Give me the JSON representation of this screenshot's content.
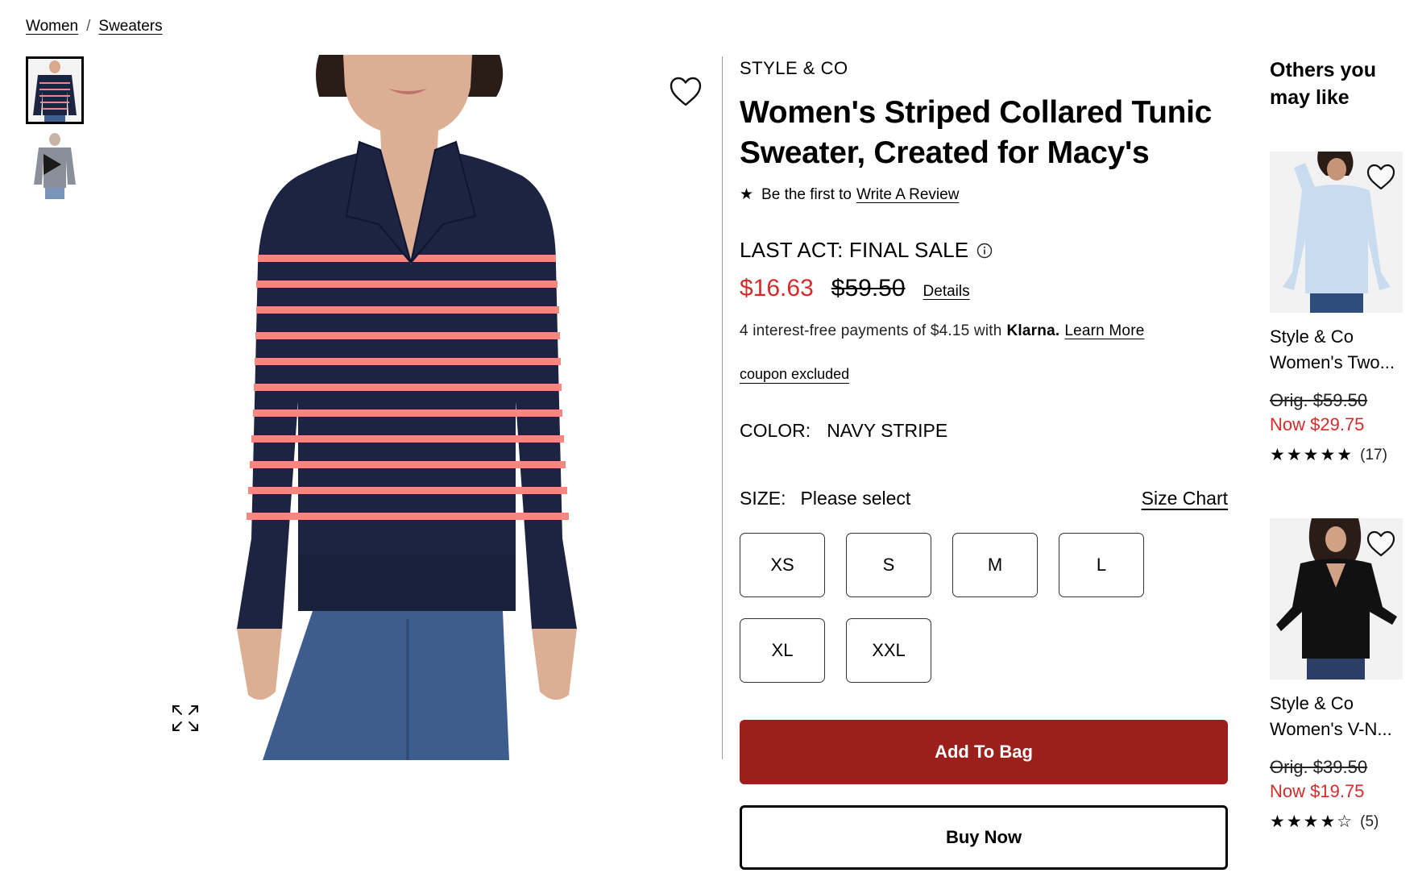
{
  "breadcrumb": {
    "items": [
      "Women",
      "Sweaters"
    ],
    "separator": "/"
  },
  "gallery": {
    "thumbnails": [
      {
        "icon": "sweater-thumbnail",
        "active": true
      },
      {
        "icon": "video-thumbnail",
        "active": false
      }
    ]
  },
  "product": {
    "brand": "STYLE & CO",
    "title": "Women's Striped Collared Tunic Sweater, Created for Macy's",
    "review": {
      "star": "★",
      "prefix": "Be the first to",
      "link": "Write A Review"
    },
    "sale_label": "LAST ACT: FINAL SALE",
    "price_now": "$16.63",
    "price_orig": "$59.50",
    "details_link": "Details",
    "klarna": {
      "text": "4 interest-free payments of $4.15 with",
      "brand": "Klarna.",
      "link": "Learn More"
    },
    "coupon": "coupon excluded",
    "color": {
      "label": "COLOR:",
      "value": "NAVY STRIPE"
    },
    "size": {
      "label": "SIZE:",
      "value": "Please select",
      "chart_link": "Size Chart"
    },
    "sizes": [
      "XS",
      "S",
      "M",
      "L",
      "XL",
      "XXL"
    ],
    "add_to_bag": "Add To Bag",
    "buy_now": "Buy Now"
  },
  "recommendations": {
    "heading": "Others you may like",
    "items": [
      {
        "name_line1": "Style & Co",
        "name_line2": "Women's Two...",
        "orig": "Orig. $59.50",
        "now": "Now $29.75",
        "stars": "★★★★★",
        "rating": 5,
        "count": "(17)"
      },
      {
        "name_line1": "Style & Co",
        "name_line2": "Women's V-N...",
        "orig": "Orig. $39.50",
        "now": "Now $19.75",
        "stars": "★★★★☆",
        "rating": 4,
        "count": "(5)"
      }
    ]
  },
  "colors": {
    "accent_red": "#d62b2b",
    "button_red": "#9b1f1a",
    "sweater_navy": "#1c2442",
    "stripe_coral": "#f08a80"
  }
}
